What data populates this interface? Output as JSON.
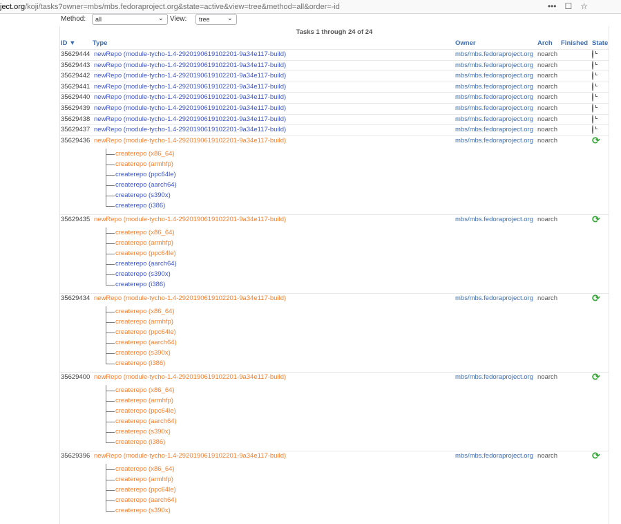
{
  "browser": {
    "url_host_part": "ject.org",
    "url_path": "/koji/tasks?owner=mbs/mbs.fedoraproject.org&state=active&view=tree&method=all&order=-id",
    "more_icon": "ellipsis-icon",
    "pocket_icon": "pocket-icon",
    "bookmark_icon": "star-icon"
  },
  "filters": {
    "method_label": "Method:",
    "method_value": "all",
    "view_label": "View:",
    "view_value": "tree"
  },
  "table": {
    "caption": "Tasks 1 through 24 of 24",
    "headers": {
      "id": "ID ▼",
      "type": "Type",
      "owner": "Owner",
      "arch": "Arch",
      "finished": "Finished",
      "state": "State"
    },
    "free_tasks": [
      {
        "id": "35629444",
        "type": "newRepo (module-tycho-1.4-2920190619102201-9a34e117-build)",
        "owner": "mbs/mbs.fedoraproject.org",
        "arch": "noarch",
        "state": "free"
      },
      {
        "id": "35629443",
        "type": "newRepo (module-tycho-1.4-2920190619102201-9a34e117-build)",
        "owner": "mbs/mbs.fedoraproject.org",
        "arch": "noarch",
        "state": "free"
      },
      {
        "id": "35629442",
        "type": "newRepo (module-tycho-1.4-2920190619102201-9a34e117-build)",
        "owner": "mbs/mbs.fedoraproject.org",
        "arch": "noarch",
        "state": "free"
      },
      {
        "id": "35629441",
        "type": "newRepo (module-tycho-1.4-2920190619102201-9a34e117-build)",
        "owner": "mbs/mbs.fedoraproject.org",
        "arch": "noarch",
        "state": "free"
      },
      {
        "id": "35629440",
        "type": "newRepo (module-tycho-1.4-2920190619102201-9a34e117-build)",
        "owner": "mbs/mbs.fedoraproject.org",
        "arch": "noarch",
        "state": "free"
      },
      {
        "id": "35629439",
        "type": "newRepo (module-tycho-1.4-2920190619102201-9a34e117-build)",
        "owner": "mbs/mbs.fedoraproject.org",
        "arch": "noarch",
        "state": "free"
      },
      {
        "id": "35629438",
        "type": "newRepo (module-tycho-1.4-2920190619102201-9a34e117-build)",
        "owner": "mbs/mbs.fedoraproject.org",
        "arch": "noarch",
        "state": "free"
      },
      {
        "id": "35629437",
        "type": "newRepo (module-tycho-1.4-2920190619102201-9a34e117-build)",
        "owner": "mbs/mbs.fedoraproject.org",
        "arch": "noarch",
        "state": "free"
      }
    ],
    "open_tasks": [
      {
        "id": "35629436",
        "type": "newRepo (module-tycho-1.4-2920190619102201-9a34e117-build)",
        "owner": "mbs/mbs.fedoraproject.org",
        "arch": "noarch",
        "state": "open",
        "children": [
          {
            "label": "createrepo (x86_64)",
            "color": "orange"
          },
          {
            "label": "createrepo (armhfp)",
            "color": "orange"
          },
          {
            "label": "createrepo (ppc64le)",
            "color": "blue"
          },
          {
            "label": "createrepo (aarch64)",
            "color": "blue"
          },
          {
            "label": "createrepo (s390x)",
            "color": "blue"
          },
          {
            "label": "createrepo (i386)",
            "color": "blue"
          }
        ]
      },
      {
        "id": "35629435",
        "type": "newRepo (module-tycho-1.4-2920190619102201-9a34e117-build)",
        "owner": "mbs/mbs.fedoraproject.org",
        "arch": "noarch",
        "state": "open",
        "children": [
          {
            "label": "createrepo (x86_64)",
            "color": "orange"
          },
          {
            "label": "createrepo (armhfp)",
            "color": "orange"
          },
          {
            "label": "createrepo (ppc64le)",
            "color": "orange"
          },
          {
            "label": "createrepo (aarch64)",
            "color": "blue"
          },
          {
            "label": "createrepo (s390x)",
            "color": "blue"
          },
          {
            "label": "createrepo (i386)",
            "color": "blue"
          }
        ]
      },
      {
        "id": "35629434",
        "type": "newRepo (module-tycho-1.4-2920190619102201-9a34e117-build)",
        "owner": "mbs/mbs.fedoraproject.org",
        "arch": "noarch",
        "state": "open",
        "children": [
          {
            "label": "createrepo (x86_64)",
            "color": "orange"
          },
          {
            "label": "createrepo (armhfp)",
            "color": "orange"
          },
          {
            "label": "createrepo (ppc64le)",
            "color": "orange"
          },
          {
            "label": "createrepo (aarch64)",
            "color": "orange"
          },
          {
            "label": "createrepo (s390x)",
            "color": "orange"
          },
          {
            "label": "createrepo (i386)",
            "color": "orange"
          }
        ]
      },
      {
        "id": "35629400",
        "type": "newRepo (module-tycho-1.4-2920190619102201-9a34e117-build)",
        "owner": "mbs/mbs.fedoraproject.org",
        "arch": "noarch",
        "state": "open",
        "children": [
          {
            "label": "createrepo (x86_64)",
            "color": "orange"
          },
          {
            "label": "createrepo (armhfp)",
            "color": "orange"
          },
          {
            "label": "createrepo (ppc64le)",
            "color": "orange"
          },
          {
            "label": "createrepo (aarch64)",
            "color": "orange"
          },
          {
            "label": "createrepo (s390x)",
            "color": "orange"
          },
          {
            "label": "createrepo (i386)",
            "color": "orange"
          }
        ]
      },
      {
        "id": "35629396",
        "type": "newRepo (module-tycho-1.4-2920190619102201-9a34e117-build)",
        "owner": "mbs/mbs.fedoraproject.org",
        "arch": "noarch",
        "state": "open",
        "children": [
          {
            "label": "createrepo (x86_64)",
            "color": "orange"
          },
          {
            "label": "createrepo (armhfp)",
            "color": "orange"
          },
          {
            "label": "createrepo (ppc64le)",
            "color": "orange"
          },
          {
            "label": "createrepo (aarch64)",
            "color": "orange"
          },
          {
            "label": "createrepo (s390x)",
            "color": "orange"
          }
        ]
      }
    ]
  },
  "colors": {
    "link_blue": "#3c55c8",
    "open_orange": "#f57f2e",
    "header_blue": "#3c6eb4",
    "open_state_green": "#3aa83a"
  }
}
